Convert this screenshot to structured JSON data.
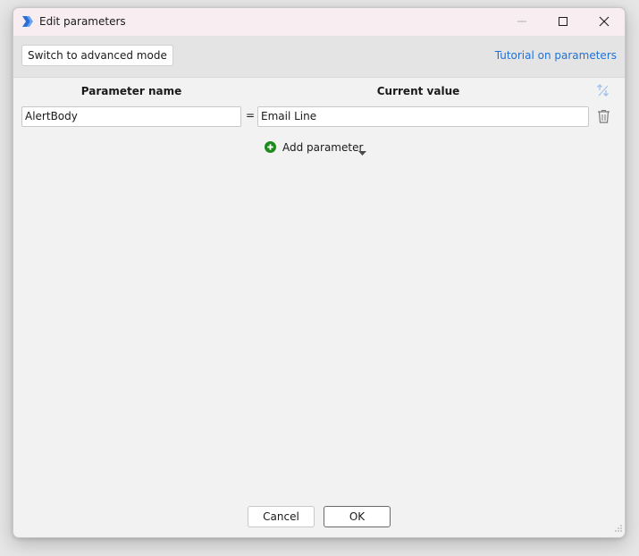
{
  "window": {
    "title": "Edit parameters",
    "app_icon": "power-automate-icon"
  },
  "toolbar": {
    "advanced_mode_label": "Switch to advanced mode",
    "tutorial_link": "Tutorial on parameters"
  },
  "table": {
    "headers": {
      "name": "Parameter name",
      "value": "Current value"
    },
    "rows": [
      {
        "name": "AlertBody",
        "separator": "=",
        "value": "Email Line"
      }
    ]
  },
  "add_parameter": {
    "label": "Add parameter",
    "icon": "plus-circle-icon"
  },
  "footer": {
    "cancel_label": "Cancel",
    "ok_label": "OK"
  },
  "colors": {
    "titlebar": "#f8eef2",
    "toolbar": "#e4e4e4",
    "link": "#1f73d6",
    "add_icon": "#1e8a1e",
    "body": "#f2f2f2"
  }
}
